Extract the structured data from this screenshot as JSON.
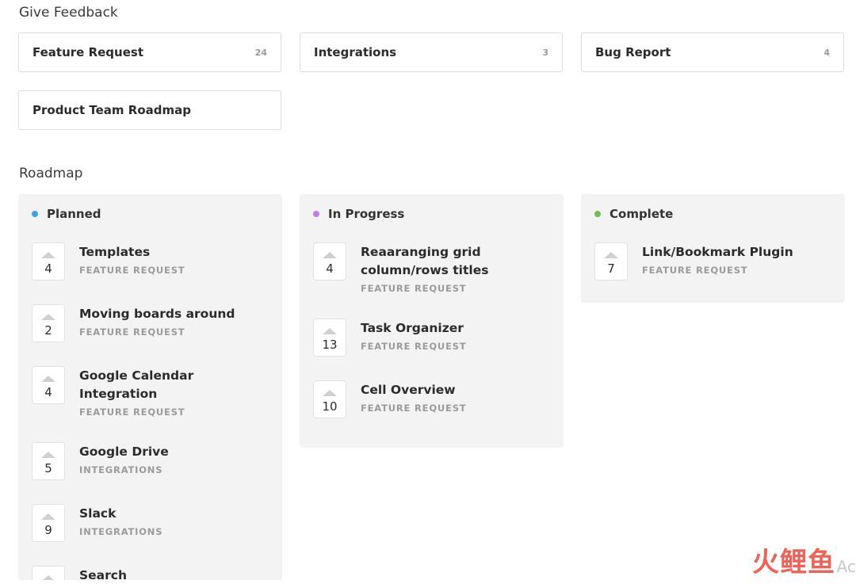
{
  "feedback_section": {
    "title": "Give Feedback",
    "boards": [
      {
        "name": "Feature Request",
        "count": "24"
      },
      {
        "name": "Integrations",
        "count": "3"
      },
      {
        "name": "Bug Report",
        "count": "4"
      },
      {
        "name": "Product Team Roadmap",
        "count": ""
      }
    ]
  },
  "roadmap_section": {
    "title": "Roadmap",
    "columns": [
      {
        "title": "Planned",
        "dot_color": "#3ba3ec",
        "posts": [
          {
            "votes": "4",
            "title": "Templates",
            "category": "FEATURE REQUEST"
          },
          {
            "votes": "2",
            "title": "Moving boards around",
            "category": "FEATURE REQUEST"
          },
          {
            "votes": "4",
            "title": "Google Calendar Integration",
            "category": "FEATURE REQUEST"
          },
          {
            "votes": "5",
            "title": "Google Drive",
            "category": "INTEGRATIONS"
          },
          {
            "votes": "9",
            "title": "Slack",
            "category": "INTEGRATIONS"
          },
          {
            "votes": "",
            "title": "Search",
            "category": ""
          }
        ]
      },
      {
        "title": "In Progress",
        "dot_color": "#c678ee",
        "posts": [
          {
            "votes": "4",
            "title": "Reaaranging grid column/rows titles",
            "category": "FEATURE REQUEST"
          },
          {
            "votes": "13",
            "title": "Task Organizer",
            "category": "FEATURE REQUEST"
          },
          {
            "votes": "10",
            "title": "Cell Overview",
            "category": "FEATURE REQUEST"
          }
        ]
      },
      {
        "title": "Complete",
        "dot_color": "#6cc24a",
        "posts": [
          {
            "votes": "7",
            "title": "Link/Bookmark Plugin",
            "category": "FEATURE REQUEST"
          }
        ]
      }
    ]
  },
  "watermark": {
    "logo_text": "火鲤鱼",
    "tail_text": "Ac"
  }
}
